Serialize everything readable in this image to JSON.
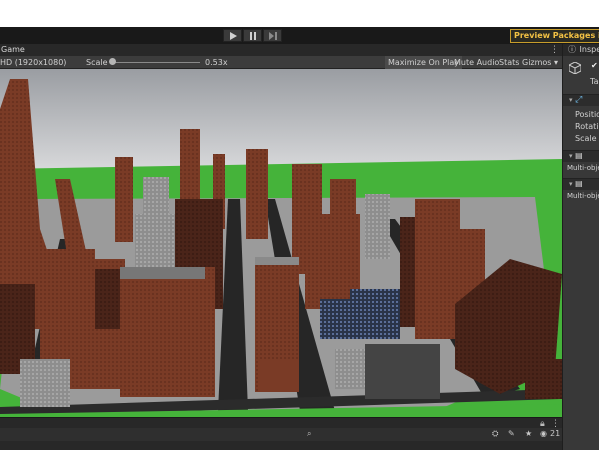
{
  "toolbar": {
    "play_icon": "play-icon",
    "pause_icon": "pause-icon",
    "step_icon": "step-icon",
    "preview_packages": "Preview Packages in Use"
  },
  "game": {
    "tab": "Game",
    "resolution": "HD (1920x1080)",
    "scale_label": "Scale",
    "scale_value": "0.53x",
    "scale_fraction": 0.02,
    "maximize": "Maximize On Play",
    "mute": "Mute Audio",
    "stats": "Stats",
    "gizmos": "Gizmos",
    "bottom_count": "21",
    "colors": {
      "grass": "#45b33a",
      "sky": "#8a8e94",
      "brick": "#7a3b26",
      "road": "#2a2a2a"
    }
  },
  "inspector": {
    "tab": "Inspector",
    "tag": "Ta",
    "position": "Position",
    "rotation": "Rotation",
    "scale": "Scale",
    "multi1": "Multi-object",
    "multi2": "Multi-object"
  }
}
